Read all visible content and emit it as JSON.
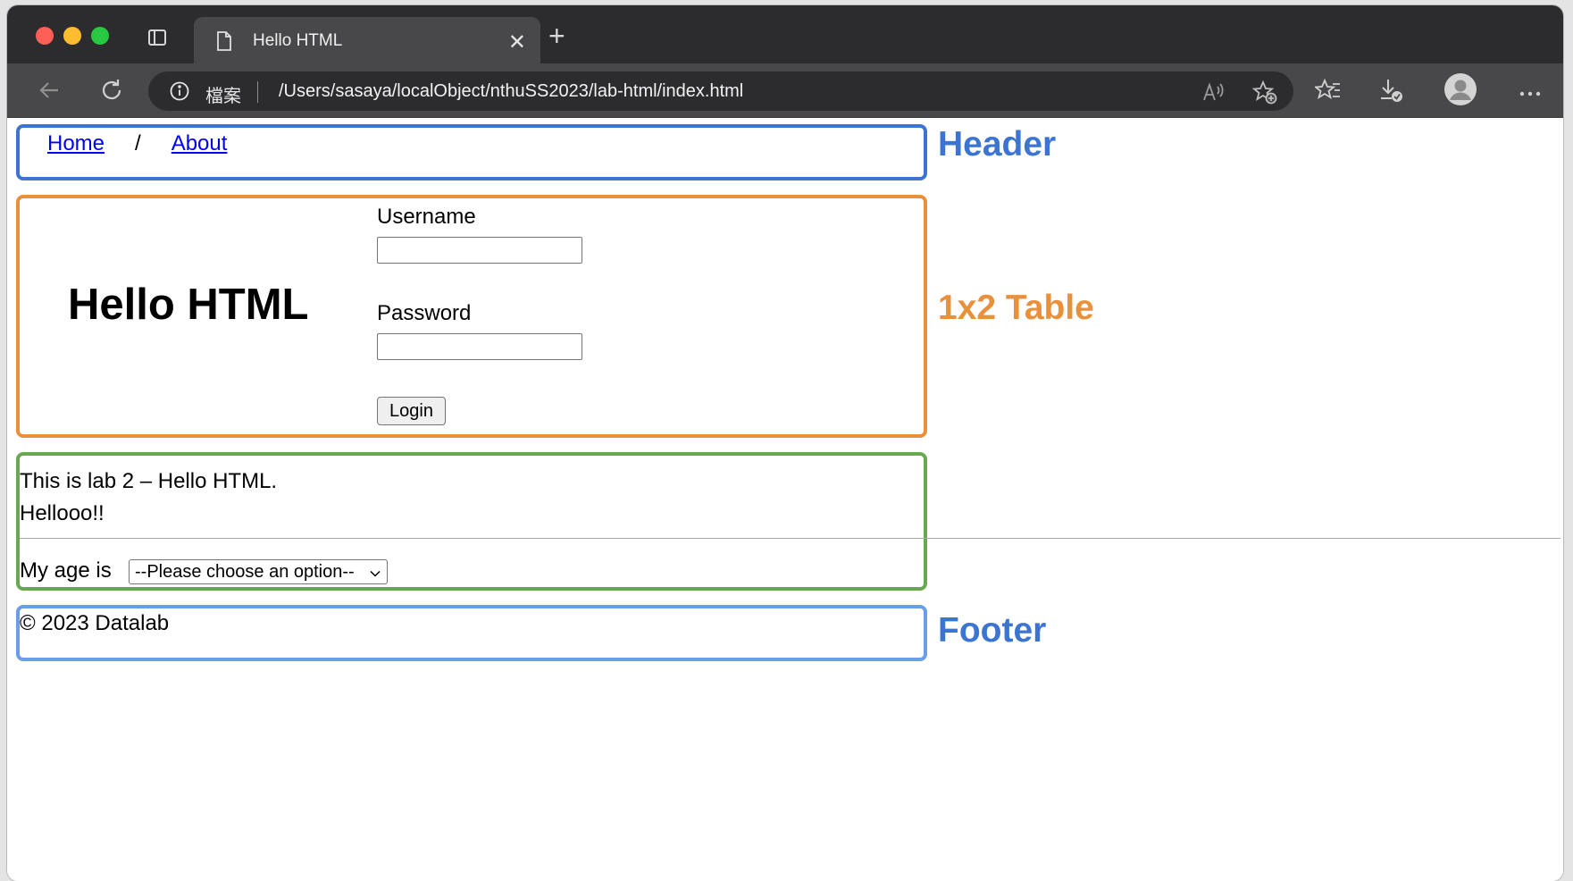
{
  "browser": {
    "tab": {
      "title": "Hello HTML"
    },
    "address_bar": {
      "site_label": "檔案",
      "url": "/Users/sasaya/localObject/nthuSS2023/lab-html/index.html"
    }
  },
  "page": {
    "nav": {
      "home": "Home",
      "separator": "/",
      "about": "About"
    },
    "heading": "Hello HTML",
    "form": {
      "username_label": "Username",
      "username_value": "",
      "password_label": "Password",
      "password_value": "",
      "login_button": "Login"
    },
    "content": {
      "line1": "This is lab 2 – Hello HTML.",
      "line2": "Hellooo!!",
      "age_label": "My age is",
      "age_select_value": "--Please choose an option--"
    },
    "footer": {
      "text": "© 2023 Datalab"
    }
  },
  "annotations": {
    "header": {
      "label": "Header",
      "color": "#3b74d1"
    },
    "table": {
      "label": "1x2 Table",
      "color": "#e8913a"
    },
    "content": {
      "label": "",
      "color": "#6aa84f"
    },
    "footer": {
      "label": "Footer",
      "color": "#6a9ee8"
    }
  }
}
